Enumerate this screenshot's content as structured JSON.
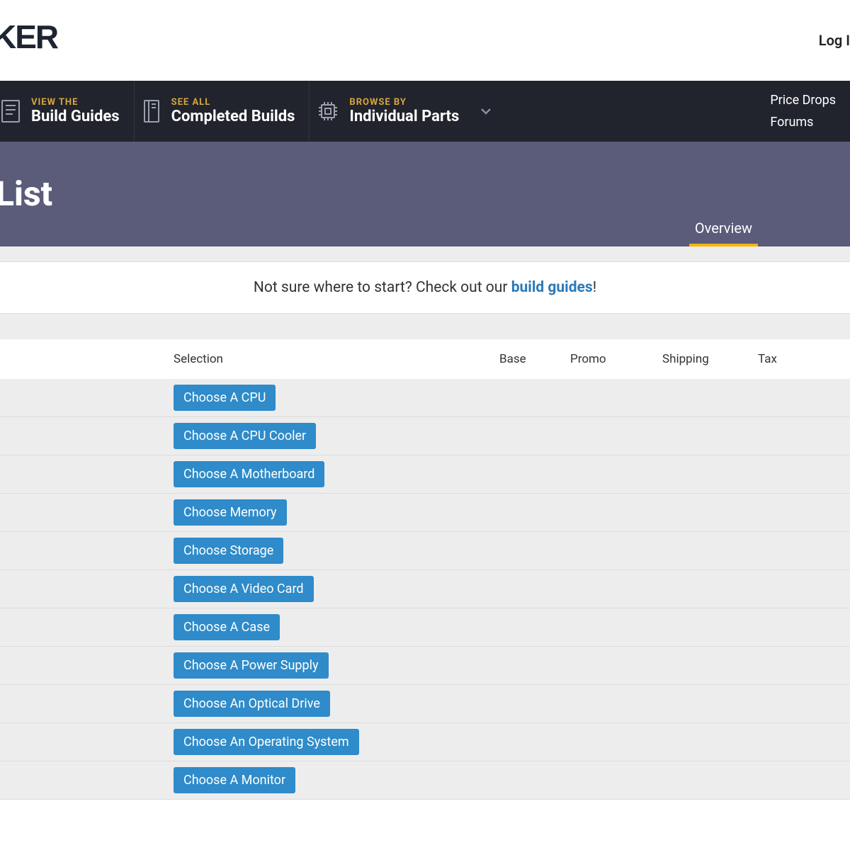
{
  "topbar": {
    "logo_fragment": "KER",
    "login": "Log I"
  },
  "nav": {
    "items": [
      {
        "eyebrow": "VIEW THE",
        "title": "Build Guides"
      },
      {
        "eyebrow": "SEE ALL",
        "title": "Completed Builds"
      },
      {
        "eyebrow": "BROWSE BY",
        "title": "Individual Parts"
      }
    ],
    "right": {
      "price_drops": "Price Drops",
      "forums": "Forums"
    }
  },
  "header": {
    "title": "List",
    "tab": "Overview"
  },
  "helper": {
    "prefix": "Not sure where to start? Check out our ",
    "link": "build guides",
    "suffix": "!"
  },
  "table": {
    "columns": {
      "selection": "Selection",
      "base": "Base",
      "promo": "Promo",
      "shipping": "Shipping",
      "tax": "Tax"
    },
    "rows": [
      {
        "label": "Choose A CPU"
      },
      {
        "label": "Choose A CPU Cooler"
      },
      {
        "label": "Choose A Motherboard"
      },
      {
        "label": "Choose Memory"
      },
      {
        "label": "Choose Storage"
      },
      {
        "label": "Choose A Video Card"
      },
      {
        "label": "Choose A Case"
      },
      {
        "label": "Choose A Power Supply"
      },
      {
        "label": "Choose An Optical Drive"
      },
      {
        "label": "Choose An Operating System"
      },
      {
        "label": "Choose A Monitor"
      }
    ]
  }
}
